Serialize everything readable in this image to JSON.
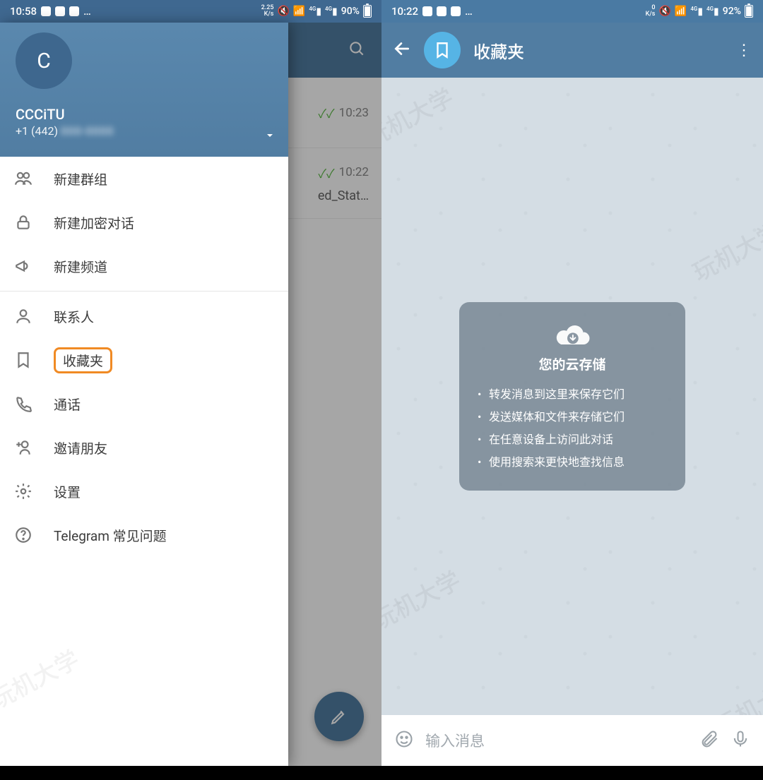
{
  "left": {
    "statusbar": {
      "time": "10:58",
      "rate": "2.25\nK/s",
      "battery": "90%"
    },
    "bg": {
      "times": [
        "10:23",
        "10:22"
      ],
      "row2_text": "ed_Stat…"
    },
    "drawer": {
      "avatar_letter": "C",
      "name": "CCCiTU",
      "phone_prefix": "+1 (442)",
      "phone_hidden": "000-0000",
      "items": [
        {
          "label": "新建群组",
          "icon": "group"
        },
        {
          "label": "新建加密对话",
          "icon": "lock"
        },
        {
          "label": "新建频道",
          "icon": "megaphone"
        }
      ],
      "items2": [
        {
          "label": "联系人",
          "icon": "person"
        },
        {
          "label": "收藏夹",
          "icon": "bookmark",
          "highlight": true
        },
        {
          "label": "通话",
          "icon": "phone"
        },
        {
          "label": "邀请朋友",
          "icon": "add-person"
        },
        {
          "label": "设置",
          "icon": "gear"
        },
        {
          "label": "Telegram 常见问题",
          "icon": "help"
        }
      ]
    }
  },
  "right": {
    "statusbar": {
      "time": "10:22",
      "rate": "0\nK/s",
      "battery": "92%"
    },
    "appbar": {
      "title": "收藏夹"
    },
    "cloud": {
      "title": "您的云存储",
      "bullets": [
        "转发消息到这里来保存它们",
        "发送媒体和文件来存储它们",
        "在任意设备上访问此对话",
        "使用搜索来更快地查找信息"
      ]
    },
    "input": {
      "placeholder": "输入消息"
    }
  },
  "watermark": "玩机大学"
}
